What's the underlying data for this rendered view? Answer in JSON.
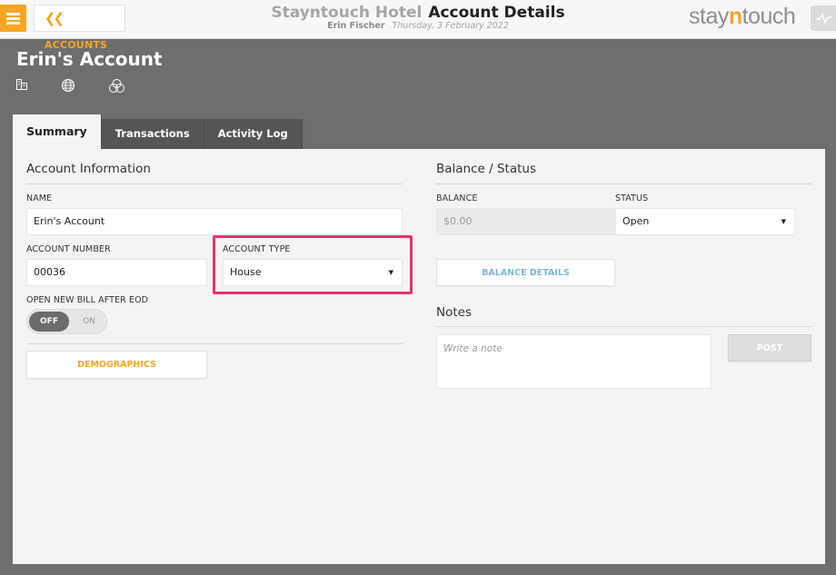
{
  "header": {
    "back_label": "ACCOUNTS",
    "hotel_name": "Stayntouch Hotel",
    "page_title": "Account Details",
    "user_name": "Erin Fischer",
    "date": "Thursday, 3 February 2022",
    "logo_pre": "stay",
    "logo_n": "n",
    "logo_post": "touch"
  },
  "account": {
    "title": "Erin's Account",
    "icons": [
      "building-icon",
      "globe-icon",
      "venn-circles-icon"
    ]
  },
  "tabs": [
    {
      "label": "Summary",
      "active": true
    },
    {
      "label": "Transactions",
      "active": false
    },
    {
      "label": "Activity Log",
      "active": false
    }
  ],
  "account_info": {
    "section_title": "Account Information",
    "name_label": "NAME",
    "name_value": "Erin's Account",
    "number_label": "ACCOUNT NUMBER",
    "number_value": "00036",
    "type_label": "ACCOUNT TYPE",
    "type_value": "House",
    "bill_label": "OPEN NEW BILL AFTER EOD",
    "toggle_off": "OFF",
    "toggle_on": "ON",
    "demographics_label": "DEMOGRAPHICS"
  },
  "balance": {
    "section_title": "Balance / Status",
    "balance_label": "BALANCE",
    "balance_value": "$0.00",
    "status_label": "STATUS",
    "status_value": "Open",
    "details_label": "BALANCE DETAILS"
  },
  "notes": {
    "section_title": "Notes",
    "placeholder": "Write a note",
    "post_label": "POST"
  },
  "colors": {
    "accent": "#f6a623",
    "highlight": "#e8336b",
    "background": "#6e6e6e"
  }
}
